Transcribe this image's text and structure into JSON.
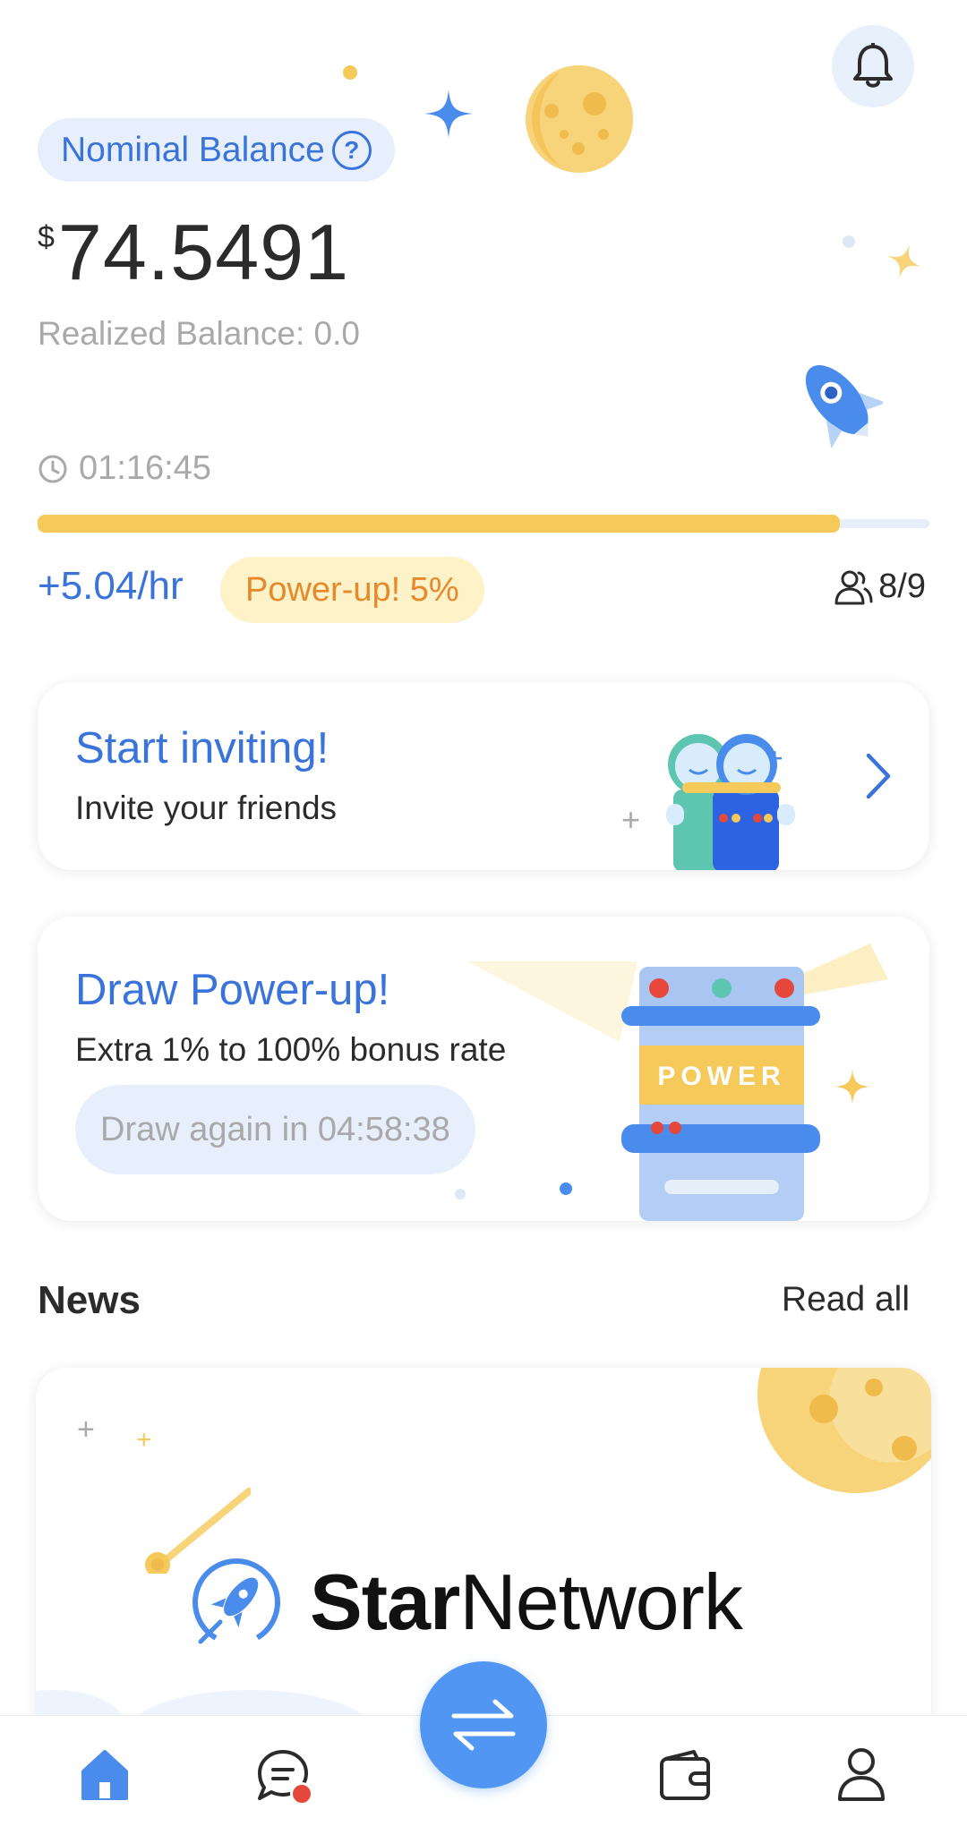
{
  "header": {
    "nominal_label": "Nominal Balance",
    "help_symbol": "?",
    "currency": "$",
    "balance": "74.5491",
    "realized": "Realized Balance: 0.0",
    "timer": "01:16:45",
    "progress_fraction": 0.9,
    "rate": "+5.04/hr",
    "powerup_badge": "Power-up! 5%",
    "team_count": "8/9",
    "icons": [
      "bell-icon",
      "help-icon",
      "clock-icon",
      "team-icon"
    ]
  },
  "invite_card": {
    "title": "Start inviting!",
    "subtitle": "Invite your friends",
    "icon": "chevron-right-icon"
  },
  "draw_card": {
    "title": "Draw Power-up!",
    "subtitle": "Extra 1% to 100% bonus rate",
    "button": "Draw again in 04:58:38",
    "machine_label": "POWER"
  },
  "news": {
    "title": "News",
    "read_all": "Read all",
    "brand_bold": "Star",
    "brand_regular": "Network"
  },
  "bottom_nav": {
    "items": [
      "home-icon",
      "chat-icon",
      "swap-icon",
      "wallet-icon",
      "profile-icon"
    ],
    "active": "home-icon"
  },
  "colors": {
    "accent": "#3a74db",
    "fab": "#5196f2",
    "progress": "#f5c95a",
    "powerup_text": "#e7892b",
    "notification_dot": "#e5483b"
  }
}
